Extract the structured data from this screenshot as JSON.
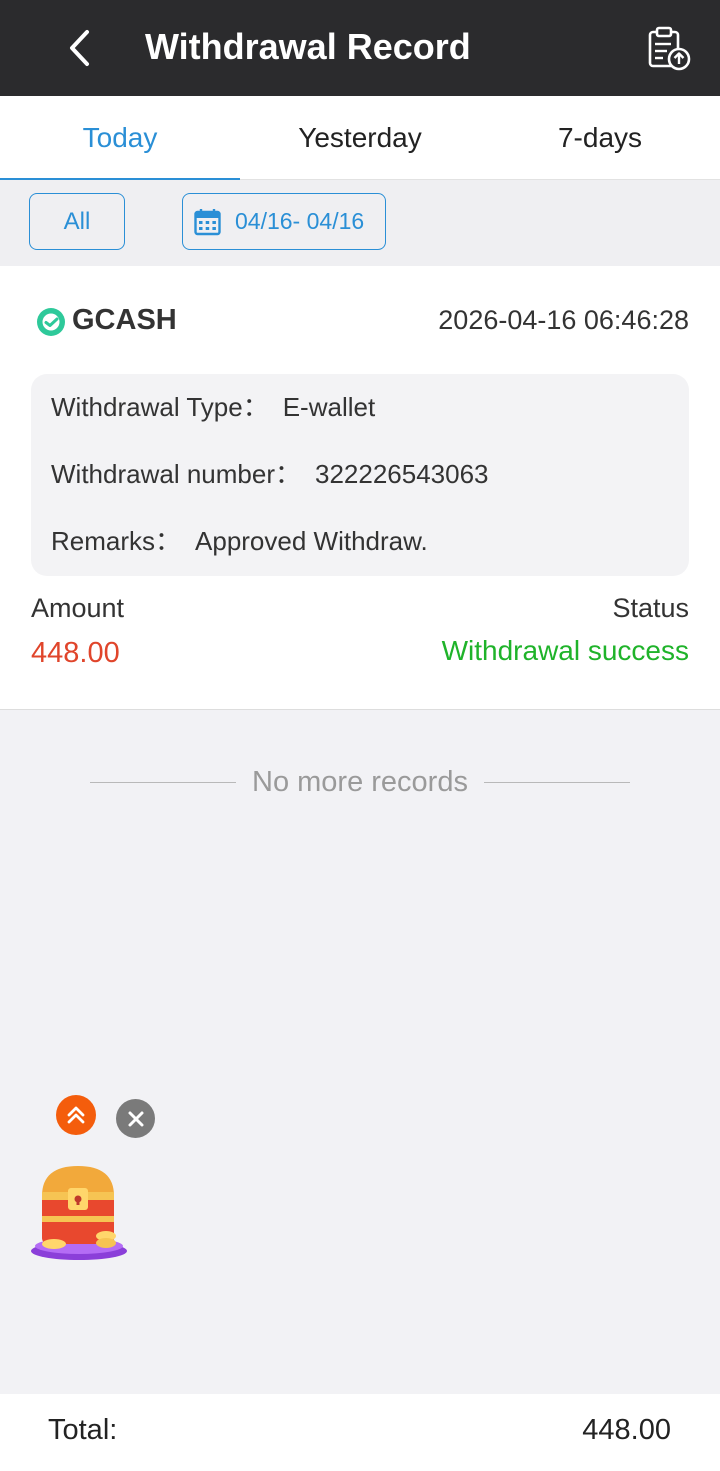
{
  "header": {
    "title": "Withdrawal Record",
    "back_icon": "back-arrow-icon",
    "action_icon": "clipboard-upload-icon"
  },
  "tabs": [
    {
      "label": "Today",
      "active": true
    },
    {
      "label": "Yesterday",
      "active": false
    },
    {
      "label": "7-days",
      "active": false
    }
  ],
  "filters": {
    "type_label": "All",
    "date_range": "04/16- 04/16",
    "date_icon": "calendar-icon"
  },
  "record": {
    "brand": "GCASH",
    "time": "2026-04-16 06:46:28",
    "withdrawal_type_label": "Withdrawal Type：",
    "withdrawal_type_value": "E-wallet",
    "withdrawal_number_label": "Withdrawal number：",
    "withdrawal_number_value": "322226543063",
    "remarks_label": "Remarks：",
    "remarks_value": "Approved Withdraw.",
    "amount_label": "Amount",
    "amount_value": "448.00",
    "status_label": "Status",
    "status_value": "Withdrawal success"
  },
  "list_end_text": "No more records",
  "footer": {
    "total_label": "Total:",
    "total_value": "448.00"
  },
  "colors": {
    "accent": "#2a8fd6",
    "header_bg": "#2b2b2d",
    "amount": "#e0452b",
    "success": "#1fb32a",
    "brand": "#2ec99a"
  }
}
